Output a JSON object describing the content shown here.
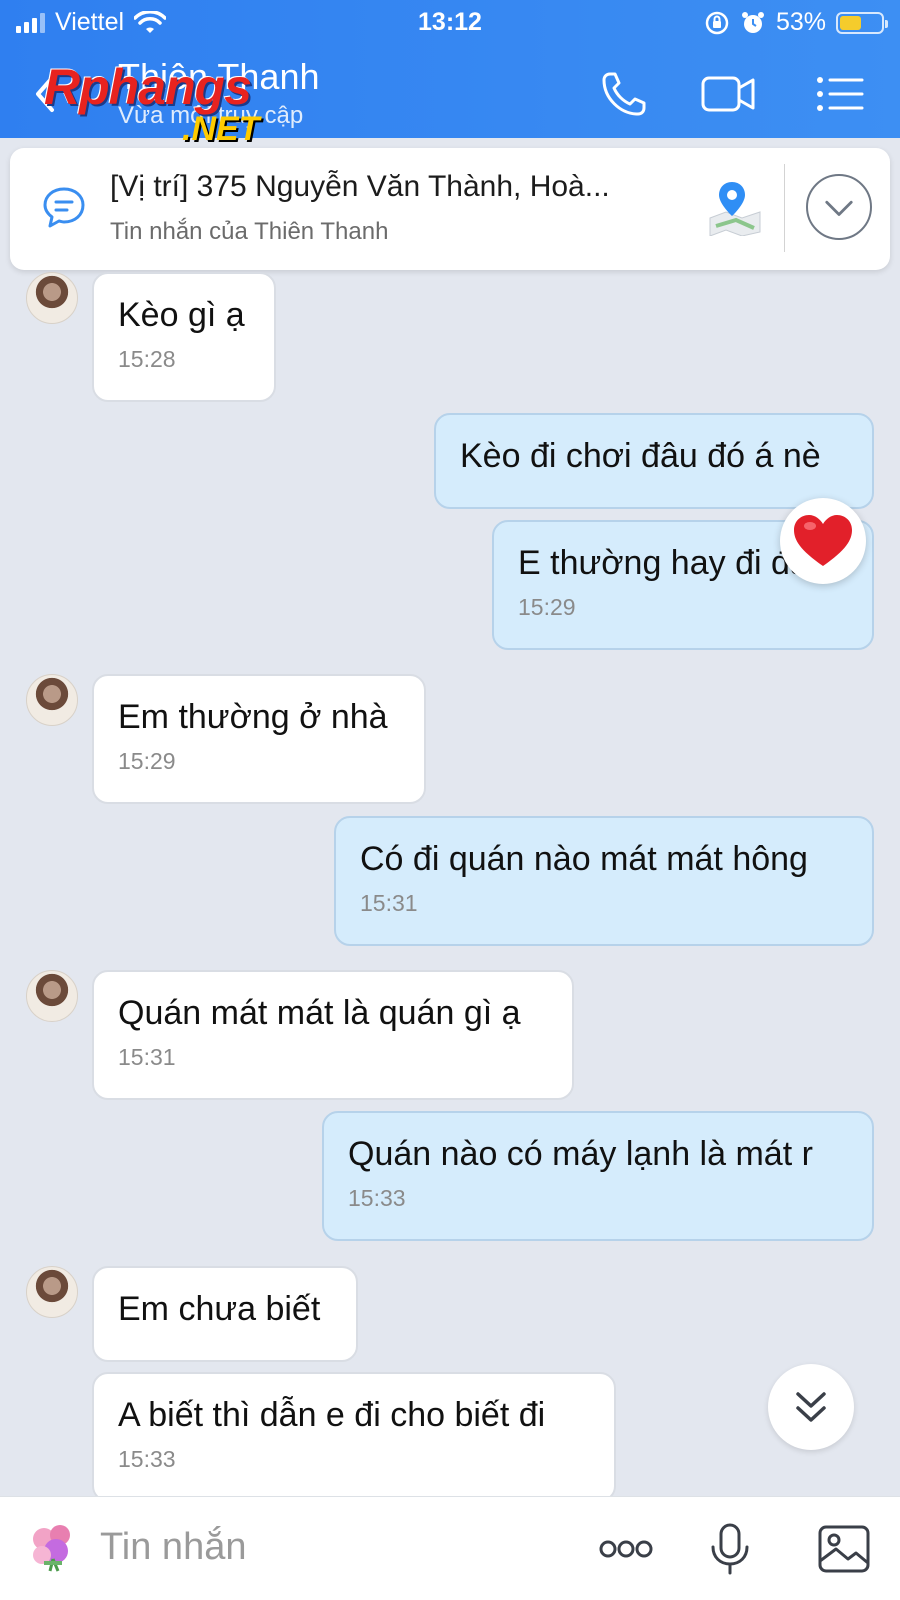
{
  "status_bar": {
    "carrier": "Viettel",
    "time": "13:12",
    "battery_percent": "53%",
    "battery_level": 0.53
  },
  "header": {
    "contact_name": "Thiên Thanh",
    "contact_status": "Vừa mới truy cập",
    "watermark_logo": "Rphangs .NET",
    "icons": [
      "phone-icon",
      "video-call-icon",
      "menu-list-icon"
    ]
  },
  "pinned": {
    "title": "[Vị trí] 375 Nguyễn Văn Thành, Hoà...",
    "subtitle": "Tin nhắn của Thiên Thanh"
  },
  "messages": [
    {
      "side": "in",
      "text": "Kèo gì ạ",
      "time": "15:28"
    },
    {
      "side": "out",
      "text": "Kèo đi chơi đâu đó á nè",
      "time": ""
    },
    {
      "side": "out",
      "text": "E thường hay đi đâu",
      "time": "15:29",
      "reaction": "heart"
    },
    {
      "side": "in",
      "text": "Em thường ở nhà",
      "time": "15:29"
    },
    {
      "side": "out",
      "text": "Có đi quán nào mát mát hông",
      "time": "15:31"
    },
    {
      "side": "in",
      "text": "Quán mát mát là quán gì ạ",
      "time": "15:31"
    },
    {
      "side": "out",
      "text": "Quán nào có máy lạnh là mát r",
      "time": "15:33"
    },
    {
      "side": "in",
      "text": "Em chưa biết",
      "time": ""
    },
    {
      "side": "in",
      "text": "A biết thì dẫn e đi cho biết đi",
      "time": "15:33"
    }
  ],
  "composer": {
    "placeholder": "Tin nhắn",
    "icons": [
      "sticker-icon",
      "more-options-icon",
      "microphone-icon",
      "image-icon"
    ]
  },
  "colors": {
    "header_bg": "#3d8ff3",
    "incoming_bubble": "#ffffff",
    "outgoing_bubble": "#d5ecfc",
    "chat_bg": "#e3e7ef"
  }
}
